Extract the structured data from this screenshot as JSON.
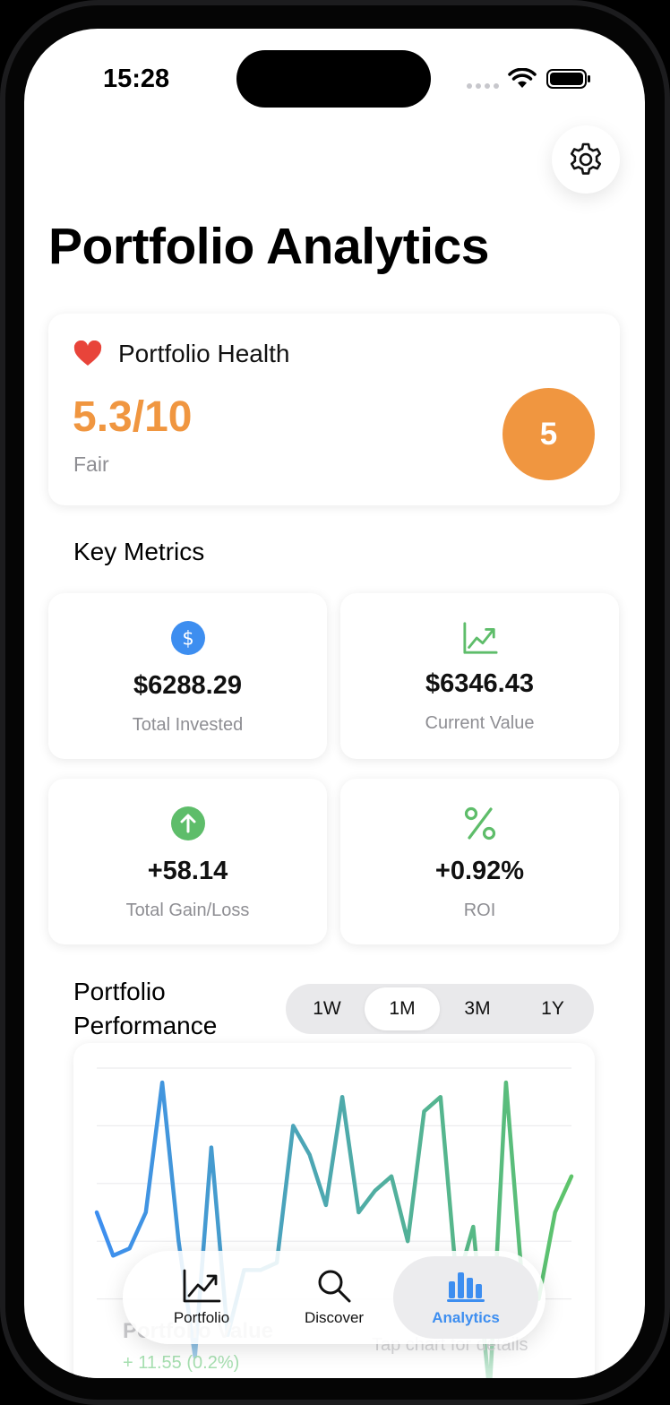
{
  "status_bar": {
    "time": "15:28"
  },
  "header": {
    "title": "Portfolio Analytics",
    "settings_icon": "gear-icon"
  },
  "health": {
    "title": "Portfolio Health",
    "score": "5.3/10",
    "status": "Fair",
    "badge": "5",
    "accent_color": "#f09640"
  },
  "key_metrics": {
    "title": "Key Metrics",
    "items": [
      {
        "value": "$6288.29",
        "label": "Total Invested",
        "icon": "dollar-circle-icon",
        "color": "#3d8ef0"
      },
      {
        "value": "$6346.43",
        "label": "Current Value",
        "icon": "chart-up-icon",
        "color": "#5ebd6a"
      },
      {
        "value": "+58.14",
        "label": "Total Gain/Loss",
        "icon": "arrow-up-circle-icon",
        "color": "#5ebd6a"
      },
      {
        "value": "+0.92%",
        "label": "ROI",
        "icon": "percent-icon",
        "color": "#5ebd6a"
      }
    ]
  },
  "performance": {
    "title": "Portfolio Performance",
    "ranges": [
      "1W",
      "1M",
      "3M",
      "1Y"
    ],
    "selected_range": "1M",
    "footer_name": "Portfolio Value",
    "footer_change": "+ 11.55 (0.2%)",
    "footer_hint": "Tap chart for details"
  },
  "chart_data": {
    "type": "line",
    "x": [
      1,
      2,
      3,
      4,
      5,
      6,
      7,
      8,
      9,
      10,
      11,
      12,
      13,
      14,
      15,
      16,
      17,
      18,
      19,
      20,
      21,
      22,
      23,
      24,
      25,
      26,
      27,
      28,
      29,
      30
    ],
    "values": [
      6340,
      6334,
      6335,
      6340,
      6358,
      6336,
      6320,
      6349,
      6323,
      6332,
      6332,
      6333,
      6352,
      6348,
      6341,
      6356,
      6340,
      6343,
      6345,
      6336,
      6354,
      6356,
      6330,
      6338,
      6315,
      6358,
      6330,
      6328,
      6340,
      6345
    ],
    "ylim": [
      6320,
      6360
    ],
    "grid": true,
    "line_gradient": [
      "#3d8ef0",
      "#5ec46a"
    ]
  },
  "tabbar": {
    "tabs": [
      {
        "label": "Portfolio",
        "icon": "line-chart-icon"
      },
      {
        "label": "Discover",
        "icon": "search-icon"
      },
      {
        "label": "Analytics",
        "icon": "bar-chart-icon"
      }
    ],
    "active": "Analytics",
    "active_color": "#3d8ef0"
  }
}
